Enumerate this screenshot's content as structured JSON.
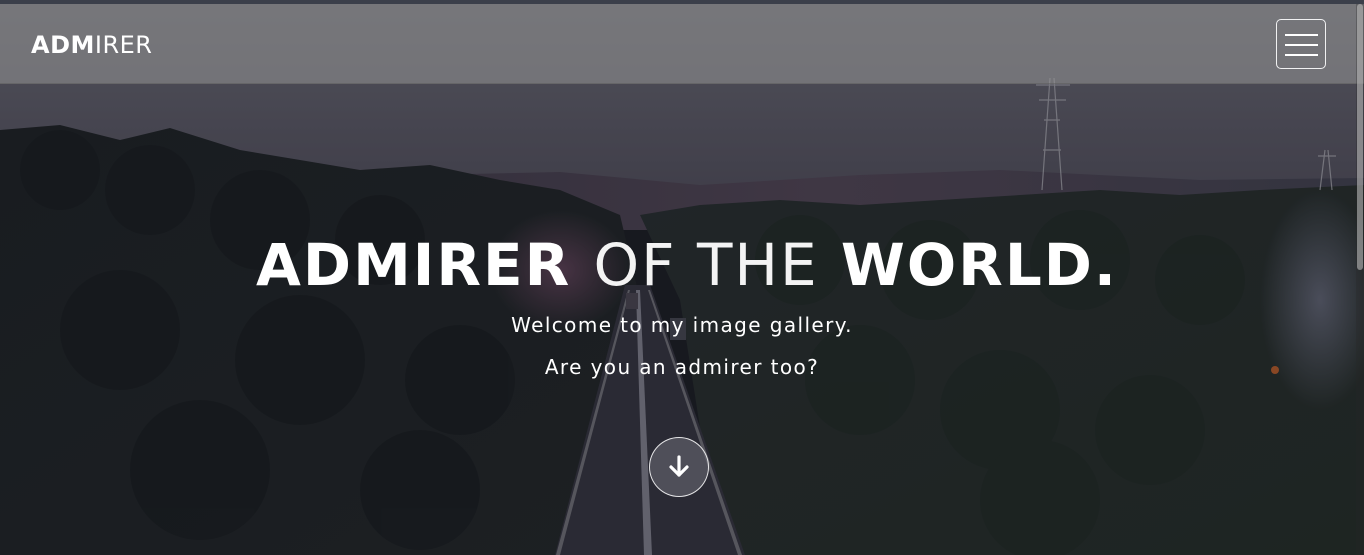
{
  "colors": {
    "navbar_bg": "#969696",
    "text": "#ffffff",
    "top_strip": "#3b3f4a"
  },
  "navbar": {
    "brand_bold": "ADM",
    "brand_light": "IRER",
    "menu_icon": "hamburger-menu-icon"
  },
  "hero": {
    "title_part1": "ADMIRER",
    "title_part2": "OF THE",
    "title_part3": "WORLD.",
    "subtitle_line1": "Welcome to my image gallery.",
    "subtitle_line2": "Are you an admirer too?",
    "scroll_icon": "arrow-down-icon"
  }
}
